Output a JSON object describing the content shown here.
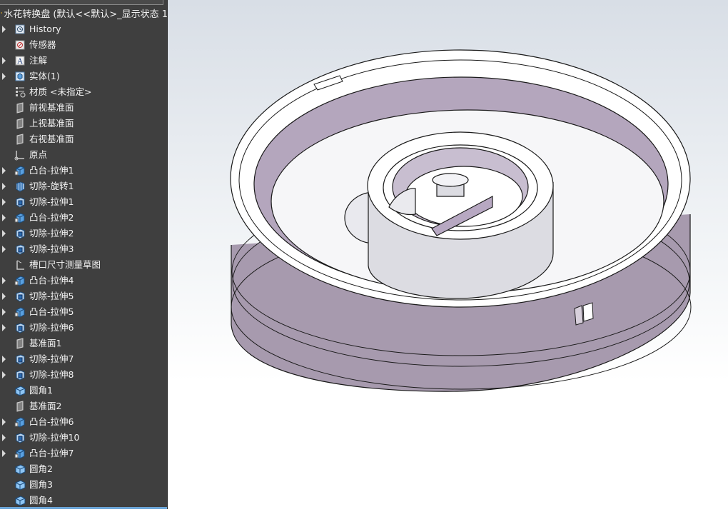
{
  "feature_tree": {
    "root": {
      "label": "水花转换盘 (默认<<默认>_显示状态 1",
      "icon": "part-icon"
    },
    "items": [
      {
        "label": "History",
        "icon": "history-icon",
        "expandable": true
      },
      {
        "label": "传感器",
        "icon": "sensor-icon",
        "expandable": false
      },
      {
        "label": "注解",
        "icon": "annotation-icon",
        "expandable": true
      },
      {
        "label": "实体(1)",
        "icon": "solid-bodies-icon",
        "expandable": true
      },
      {
        "label": "材质 <未指定>",
        "icon": "material-icon",
        "expandable": false
      },
      {
        "label": "前视基准面",
        "icon": "plane-icon",
        "expandable": false
      },
      {
        "label": "上视基准面",
        "icon": "plane-icon",
        "expandable": false
      },
      {
        "label": "右视基准面",
        "icon": "plane-icon",
        "expandable": false
      },
      {
        "label": "原点",
        "icon": "origin-icon",
        "expandable": false
      },
      {
        "label": "凸台-拉伸1",
        "icon": "boss-extrude-icon",
        "expandable": true
      },
      {
        "label": "切除-旋转1",
        "icon": "cut-revolve-icon",
        "expandable": true
      },
      {
        "label": "切除-拉伸1",
        "icon": "cut-extrude-icon",
        "expandable": true
      },
      {
        "label": "凸台-拉伸2",
        "icon": "boss-extrude-icon",
        "expandable": true
      },
      {
        "label": "切除-拉伸2",
        "icon": "cut-extrude-icon",
        "expandable": true
      },
      {
        "label": "切除-拉伸3",
        "icon": "cut-extrude-icon",
        "expandable": true
      },
      {
        "label": "槽口尺寸测量草图",
        "icon": "sketch-icon",
        "expandable": false
      },
      {
        "label": "凸台-拉伸4",
        "icon": "boss-extrude-icon",
        "expandable": true
      },
      {
        "label": "切除-拉伸5",
        "icon": "cut-extrude-icon",
        "expandable": true
      },
      {
        "label": "凸台-拉伸5",
        "icon": "boss-extrude-icon",
        "expandable": true
      },
      {
        "label": "切除-拉伸6",
        "icon": "cut-extrude-icon",
        "expandable": true
      },
      {
        "label": "基准面1",
        "icon": "plane-icon",
        "expandable": false
      },
      {
        "label": "切除-拉伸7",
        "icon": "cut-extrude-icon",
        "expandable": true
      },
      {
        "label": "切除-拉伸8",
        "icon": "cut-extrude-icon",
        "expandable": true
      },
      {
        "label": "圆角1",
        "icon": "fillet-icon",
        "expandable": false
      },
      {
        "label": "基准面2",
        "icon": "plane-icon",
        "expandable": false
      },
      {
        "label": "凸台-拉伸6",
        "icon": "boss-extrude-icon",
        "expandable": true
      },
      {
        "label": "切除-拉伸10",
        "icon": "cut-extrude-icon",
        "expandable": true
      },
      {
        "label": "凸台-拉伸7",
        "icon": "boss-extrude-icon",
        "expandable": true
      },
      {
        "label": "圆角2",
        "icon": "fillet-icon",
        "expandable": false
      },
      {
        "label": "圆角3",
        "icon": "fillet-icon",
        "expandable": false
      },
      {
        "label": "圆角4",
        "icon": "fillet-icon",
        "expandable": false
      }
    ]
  },
  "colors": {
    "panel_bg": "#3f3f3f",
    "text": "#f2f2f2",
    "model_face": "#ffffff",
    "model_wall": "#b8a9c0",
    "model_edge": "#1a1a1a"
  }
}
